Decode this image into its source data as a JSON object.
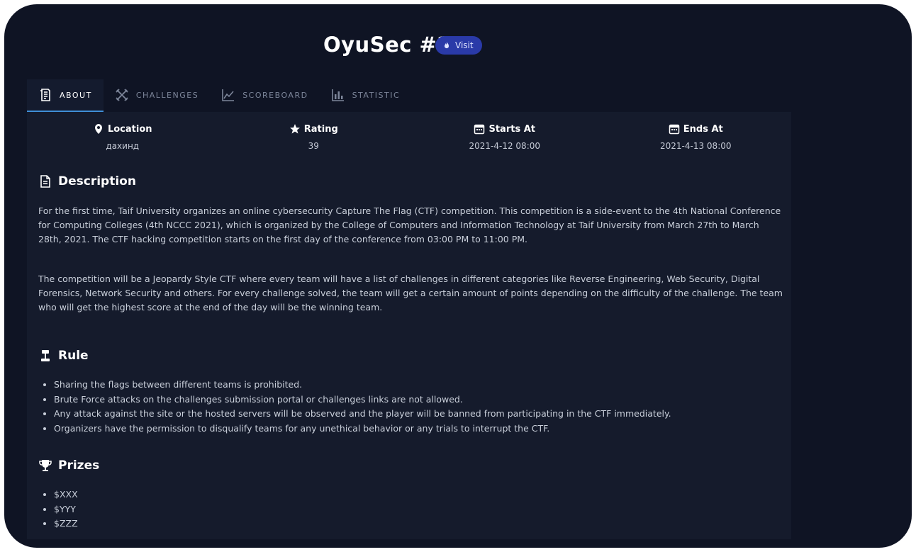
{
  "header": {
    "title": "OyuSec #2",
    "badge_label": "Visit"
  },
  "tabs": [
    {
      "label": "ABOUT",
      "icon": "document-icon"
    },
    {
      "label": "CHALLENGES",
      "icon": "crossed-swords-icon"
    },
    {
      "label": "SCOREBOARD",
      "icon": "line-chart-icon"
    },
    {
      "label": "STATISTIC",
      "icon": "bar-chart-icon"
    }
  ],
  "stats": {
    "location": {
      "label": "Location",
      "value": "дахинд"
    },
    "rating": {
      "label": "Rating",
      "value": "39"
    },
    "starts": {
      "label": "Starts At",
      "value": "2021-4-12 08:00"
    },
    "ends": {
      "label": "Ends At",
      "value": "2021-4-13 08:00"
    }
  },
  "description": {
    "heading": "Description",
    "paragraphs": [
      "For the first time, Taif University organizes an online cybersecurity Capture The Flag (CTF) competition. This competition is a side-event to the 4th National Conference for Computing Colleges (4th NCCC 2021), which is organized by the College of Computers and Information Technology at Taif University from March 27th to March 28th, 2021. The CTF hacking competition starts on the first day of the conference from 03:00 PM to 11:00 PM.",
      "The competition will be a Jeopardy Style CTF where every team will have a list of challenges in different categories like Reverse Engineering, Web Security, Digital Forensics, Network Security and others. For every challenge solved, the team will get a certain amount of points depending on the difficulty of the challenge. The team who will get the highest score at the end of the day will be the winning team."
    ]
  },
  "rule": {
    "heading": "Rule",
    "items": [
      "Sharing the flags between different teams is prohibited.",
      "Brute Force attacks on the challenges submission portal or challenges links are not allowed.",
      "Any attack against the site or the hosted servers will be observed and the player will be banned from participating in the CTF immediately.",
      "Organizers have the permission to disqualify teams for any unethical behavior or any trials to interrupt the CTF."
    ]
  },
  "prizes": {
    "heading": "Prizes",
    "items": [
      "$XXX",
      "$YYY",
      "$ZZZ"
    ]
  },
  "colors": {
    "background": "#0f1424",
    "panel": "#151b2c",
    "accent": "#3f8fd6",
    "badge": "#2a3aa8"
  }
}
